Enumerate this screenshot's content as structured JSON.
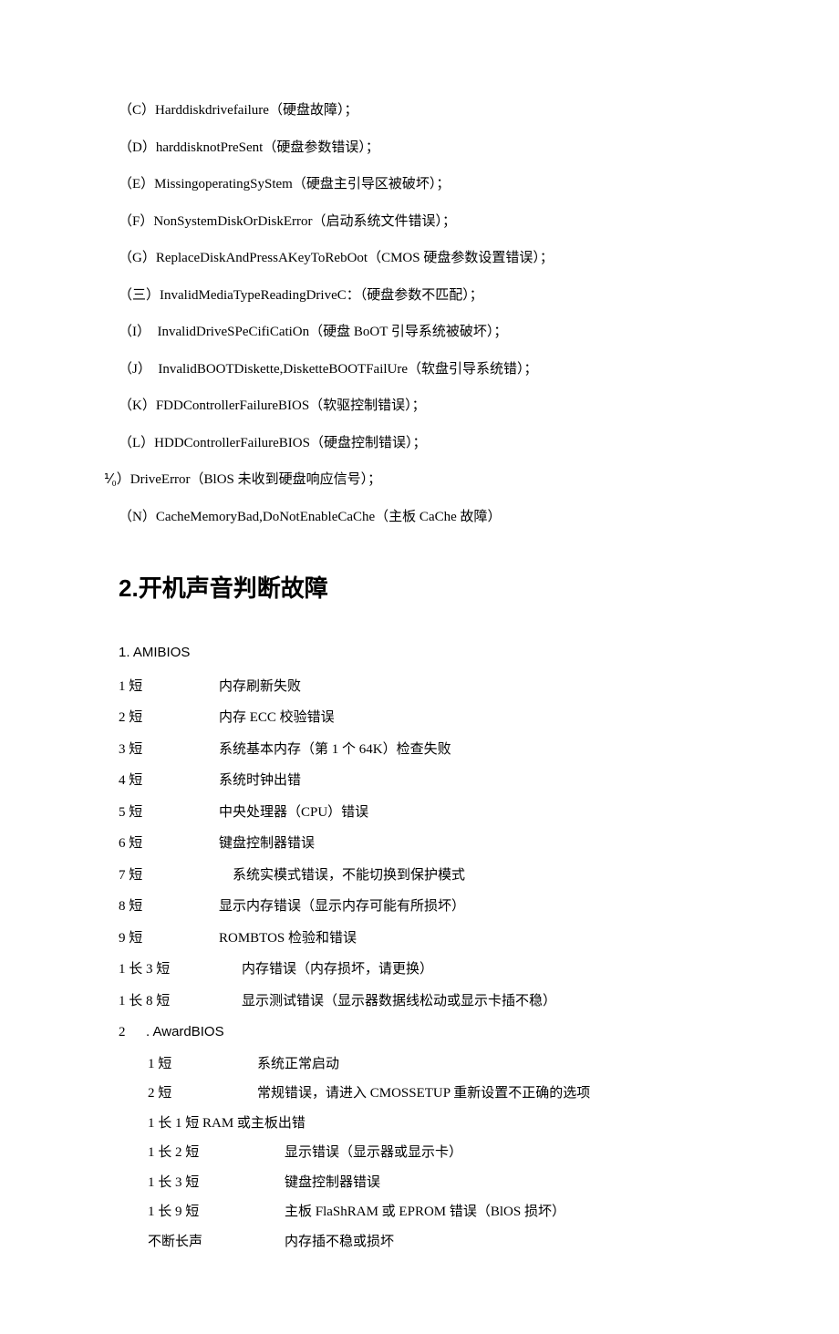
{
  "errors": [
    "（C）Harddiskdrivefailure（硬盘故障）；",
    "（D）harddisknotPreSent（硬盘参数错误）；",
    "（E）MissingoperatingSyStem（硬盘主引导区被破坏）；",
    "（F）NonSystemDiskOrDiskError（启动系统文件错误）；",
    "（G）ReplaceDiskAndPressAKeyToRebOot（CMOS 硬盘参数设置错误）；",
    "（三）InvalidMediaTypeReadingDriveC：（硬盘参数不匹配）；",
    "（I）　InvalidDriveSPeCifiCatiOn（硬盘 BoOT 引导系统被破坏）；",
    "（J）　InvalidBOOTDiskette,DisketteBOOTFailUre（软盘引导系统错）；",
    "（K）FDDControllerFailureBIOS（软驱控制错误）；",
    "（L）HDDControllerFailureBIOS（硬盘控制错误）；"
  ],
  "error_m": "⅟₀）DriveError（BlOS 未收到硬盘响应信号）；",
  "error_n": "（N）CacheMemoryBad,DoNotEnableCaChe（主板 CaChe 故障）",
  "heading": {
    "num": "2.",
    "text": "开机声音判断故障"
  },
  "ami_title": "1. AMIBIOS",
  "ami": [
    {
      "beep": "1 短",
      "desc": "内存刷新失败"
    },
    {
      "beep": "2 短",
      "desc": "内存 ECC 校验错误"
    },
    {
      "beep": "3 短",
      "desc": "系统基本内存（第 1 个 64K）检查失败"
    },
    {
      "beep": "4 短",
      "desc": "系统时钟出错"
    },
    {
      "beep": "5 短",
      "desc": "中央处理器（CPU）错误"
    },
    {
      "beep": "6 短",
      "desc": "键盘控制器错误"
    },
    {
      "beep": "7 短",
      "desc": "　系统实模式错误，不能切换到保护模式"
    },
    {
      "beep": "8 短",
      "desc": "显示内存错误（显示内存可能有所损坏）"
    },
    {
      "beep": "9 短",
      "desc": "ROMBTOS 检验和错误"
    },
    {
      "beep": "1 长 3 短",
      "desc": "　内存错误（内存损坏，请更换）"
    },
    {
      "beep": "1 长 8 短",
      "desc": "　显示测试错误（显示器数据线松动或显示卡插不稳）"
    }
  ],
  "award_num": "2",
  "award_title": " . AwardBIOS",
  "award": [
    {
      "beep": "1 短",
      "desc": "系统正常启动"
    },
    {
      "beep": "2 短",
      "desc": "常规错误，请进入 CMOSSETUP 重新设置不正确的选项"
    }
  ],
  "award_full": "1 长 1 短 RAM 或主板出错",
  "award2": [
    {
      "beep": "1 长 2 短",
      "desc": "显示错误（显示器或显示卡）"
    },
    {
      "beep": "1 长 3 短",
      "desc": "键盘控制器错误"
    },
    {
      "beep": "1 长 9 短",
      "desc": "主板 FlaShRAM 或 EPROM 错误（BlOS 损坏）"
    },
    {
      "beep": "不断长声",
      "desc": "内存插不稳或损坏"
    }
  ]
}
